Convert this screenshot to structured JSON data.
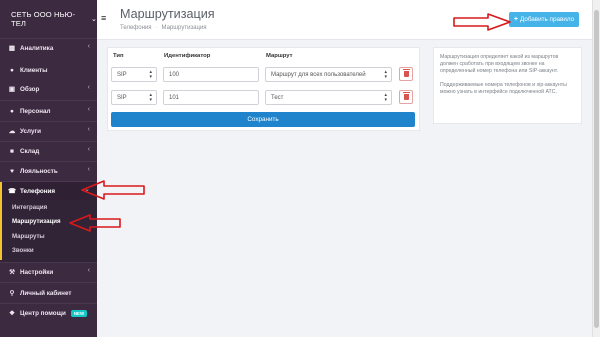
{
  "brand": {
    "name": "СЕТЬ ООО НЬЮ-ТЕЛ"
  },
  "sidebar": {
    "items": [
      {
        "label": "Аналитика",
        "icon": "chart-icon"
      },
      {
        "label": "Клиенты",
        "icon": "users-icon"
      },
      {
        "label": "Обзор",
        "icon": "dashboard-icon"
      },
      {
        "label": "Персонал",
        "icon": "person-icon"
      },
      {
        "label": "Услуги",
        "icon": "cart-icon"
      },
      {
        "label": "Склад",
        "icon": "box-icon"
      },
      {
        "label": "Лояльность",
        "icon": "heart-icon"
      },
      {
        "label": "Телефония",
        "icon": "phone-icon"
      }
    ],
    "telephony_sub": [
      "Интеграция",
      "Маршрутизация",
      "Маршруты",
      "Звонки"
    ],
    "bottom_items": [
      {
        "label": "Настройки",
        "icon": "wrench-icon"
      },
      {
        "label": "Личный кабинет",
        "icon": "key-icon"
      },
      {
        "label": "Центр помощи",
        "icon": "help-icon",
        "badge": "NEW"
      }
    ]
  },
  "header": {
    "title": "Маршрутизация",
    "breadcrumb": [
      "Телефония",
      "Маршрутизация"
    ],
    "add_button": "Добавить правило"
  },
  "table": {
    "columns": [
      "Тип",
      "Идентификатор",
      "Маршрут"
    ],
    "rows": [
      {
        "type": "SIP",
        "id": "100",
        "route": "Маршрут для всех пользователей"
      },
      {
        "type": "SIP",
        "id": "101",
        "route": "Тест"
      }
    ],
    "save_button": "Сохранить"
  },
  "info": {
    "p1": "Маршрутизация определяет какой из маршрутов должен сработать при входящем звонке на определенный номер телефона или SIP-аккаунт.",
    "p2": "Поддерживаемые номера телефонов и sip-аккаунты можно узнать в интерфейсе подключенной АТС."
  },
  "colors": {
    "sidebar": "#3c2a40",
    "accent": "#45b2e8",
    "save": "#1f84cc",
    "annotation": "#d9191c"
  }
}
